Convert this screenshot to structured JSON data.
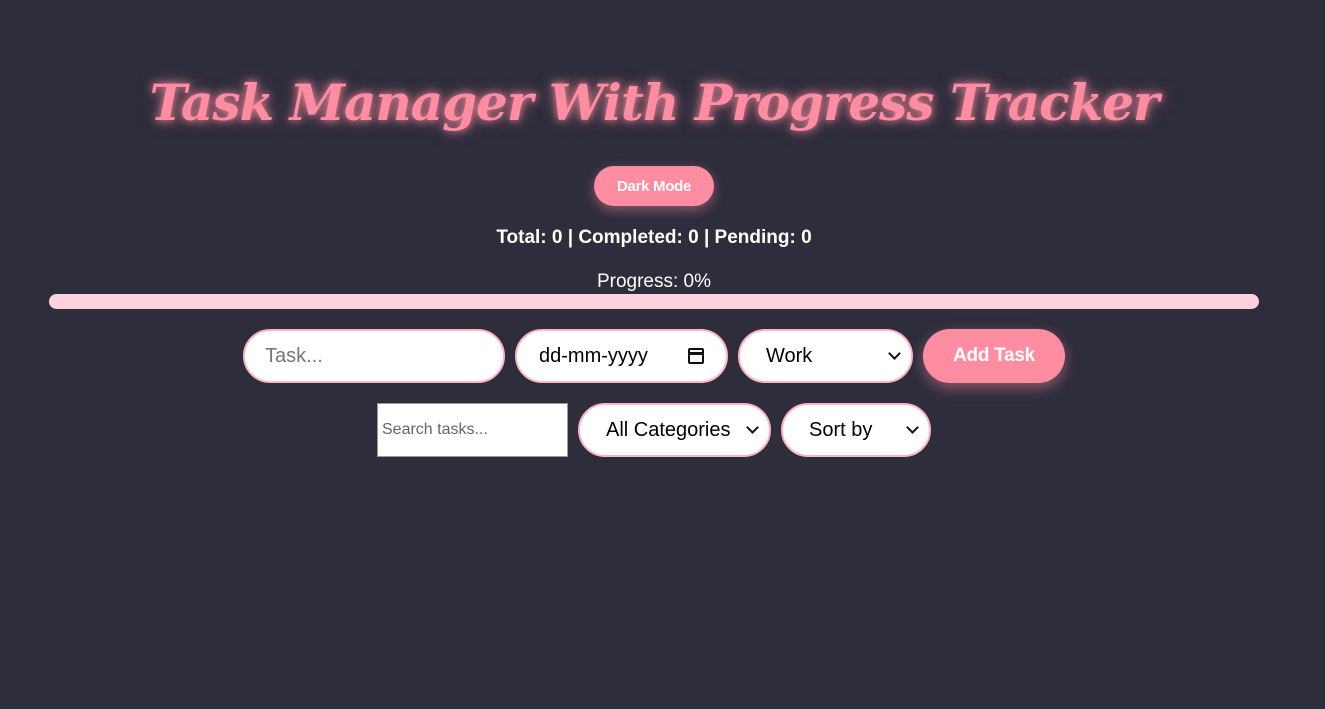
{
  "header": {
    "title": "Task Manager With Progress Tracker",
    "dark_mode_label": "Dark Mode"
  },
  "stats": {
    "text": "Total: 0 | Completed: 0 | Pending: 0",
    "total": 0,
    "completed": 0,
    "pending": 0
  },
  "progress": {
    "label": "Progress: 0%",
    "value_percent": 0
  },
  "add_form": {
    "task_placeholder": "Task...",
    "date_placeholder": "dd-mm-yyyy",
    "category_selected": "Work",
    "add_button_label": "Add Task"
  },
  "filters": {
    "search_placeholder": "Search tasks...",
    "category_filter_selected": "All Categories",
    "sort_selected": "Sort by"
  },
  "colors": {
    "background": "#2d2d3c",
    "accent": "#ff8da1",
    "progress_track": "#ffd1dc"
  },
  "icons": {
    "date_picker": "calendar-icon",
    "select": "chevron-down-icon"
  }
}
